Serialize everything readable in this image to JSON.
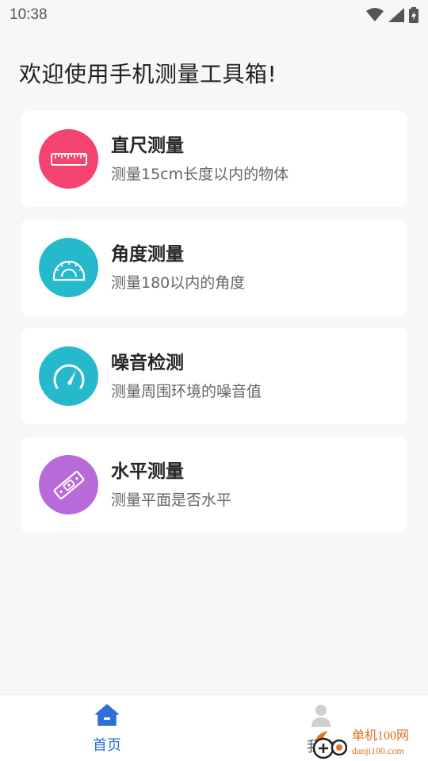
{
  "status_bar": {
    "time": "10:38"
  },
  "welcome_text": "欢迎使用手机测量工具箱!",
  "cards": [
    {
      "title": "直尺测量",
      "desc": "测量15cm长度以内的物体",
      "icon": "ruler-icon",
      "color": "#f3436e"
    },
    {
      "title": "角度测量",
      "desc": "测量180以内的角度",
      "icon": "protractor-icon",
      "color": "#26b9cc"
    },
    {
      "title": "噪音检测",
      "desc": "测量周围环境的噪音值",
      "icon": "speedometer-icon",
      "color": "#26b9cc"
    },
    {
      "title": "水平测量",
      "desc": "测量平面是否水平",
      "icon": "spirit-level-icon",
      "color": "#b86ad9"
    }
  ],
  "bottom_nav": {
    "home_label": "首页",
    "mine_label": "我的",
    "active_color": "#2f6fd8"
  },
  "watermark": {
    "name": "单机100网",
    "url": "danji100.com"
  }
}
